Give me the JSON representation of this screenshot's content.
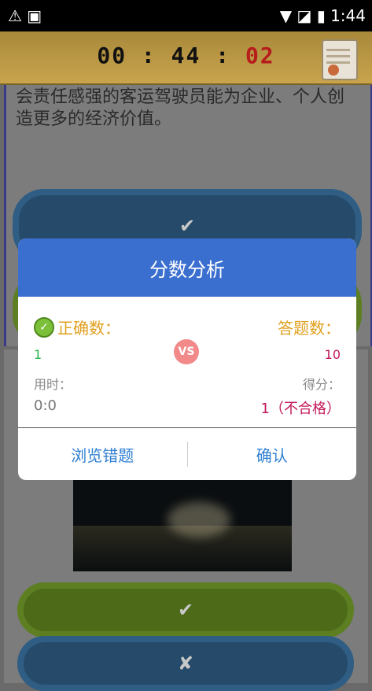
{
  "statusbar": {
    "left_icons": "⚠ ▣",
    "right_icons": "▼ ◪ ▮",
    "time": "1:44"
  },
  "timer": {
    "hours": "00",
    "minutes": "44",
    "seconds": "02",
    "sep": ":"
  },
  "question": {
    "text": "会责任感强的客运驾驶员能为企业、个人创造更多的经济价值。"
  },
  "answer_buttons": {
    "correct_symbol": "✔",
    "wrong_symbol": "✘"
  },
  "dialog": {
    "title": "分数分析",
    "correct_label": "正确数：",
    "answered_label": "答题数：",
    "correct_value": "1",
    "answered_value": "10",
    "vs": "VS",
    "time_label": "用时：",
    "time_value": "0:0",
    "score_label": "得分：",
    "score_value": "1（不合格）",
    "review_button": "浏览错题",
    "confirm_button": "确认"
  },
  "colors": {
    "header": "#3b6fcf",
    "accent": "#e0a020",
    "score": "#c2185b",
    "correct": "#27b84a",
    "link": "#2f7fd1"
  }
}
